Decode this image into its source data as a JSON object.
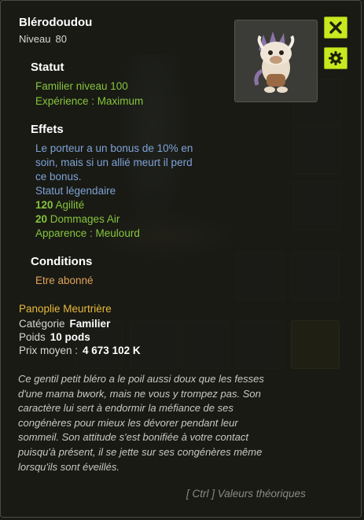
{
  "item": {
    "name": "Blérodoudou",
    "level_label": "Niveau",
    "level_value": "80"
  },
  "statut": {
    "heading": "Statut",
    "lines": [
      "Familier niveau 100",
      "Expérience : Maximum"
    ]
  },
  "effets": {
    "heading": "Effets",
    "bonus_text_lines": [
      "Le porteur a un bonus de 10% en",
      "soin, mais si un allié meurt il perd",
      "ce bonus."
    ],
    "legendary": "Statut légendaire",
    "stats": [
      {
        "value": "120",
        "label": "Agilité"
      },
      {
        "value": "20",
        "label": "Dommages Air"
      }
    ],
    "apparence": "Apparence : Meulourd"
  },
  "conditions": {
    "heading": "Conditions",
    "line": "Etre abonné"
  },
  "panoplie": "Panoplie Meurtrière",
  "categorie": {
    "label": "Catégorie",
    "value": "Familier"
  },
  "poids": {
    "label": "Poids",
    "value": "10 pods"
  },
  "prix": {
    "label": "Prix moyen :",
    "value": "4 673 102 K"
  },
  "description_lines": [
    "Ce gentil petit bléro a le poil aussi doux que les fesses",
    "d'une mama bwork, mais ne vous y trompez pas. Son",
    "caractère lui sert à endormir la méfiance de ses",
    "congénères pour mieux les dévorer pendant leur",
    "sommeil. Son attitude s'est bonifiée à votre contact",
    "puisqu'à présent, il se jette sur ses congénères même",
    "lorsqu'ils sont éveillés."
  ],
  "footer": "[ Ctrl ] Valeurs théoriques",
  "icons": {
    "close": "close-icon",
    "settings": "gear-icon",
    "pet": "pet-portrait"
  },
  "colors": {
    "accent": "#c8e820",
    "green_text": "#86c43d",
    "blue_text": "#7ea2d6",
    "orange_text": "#e0a25a",
    "gold_text": "#e8b93a"
  }
}
